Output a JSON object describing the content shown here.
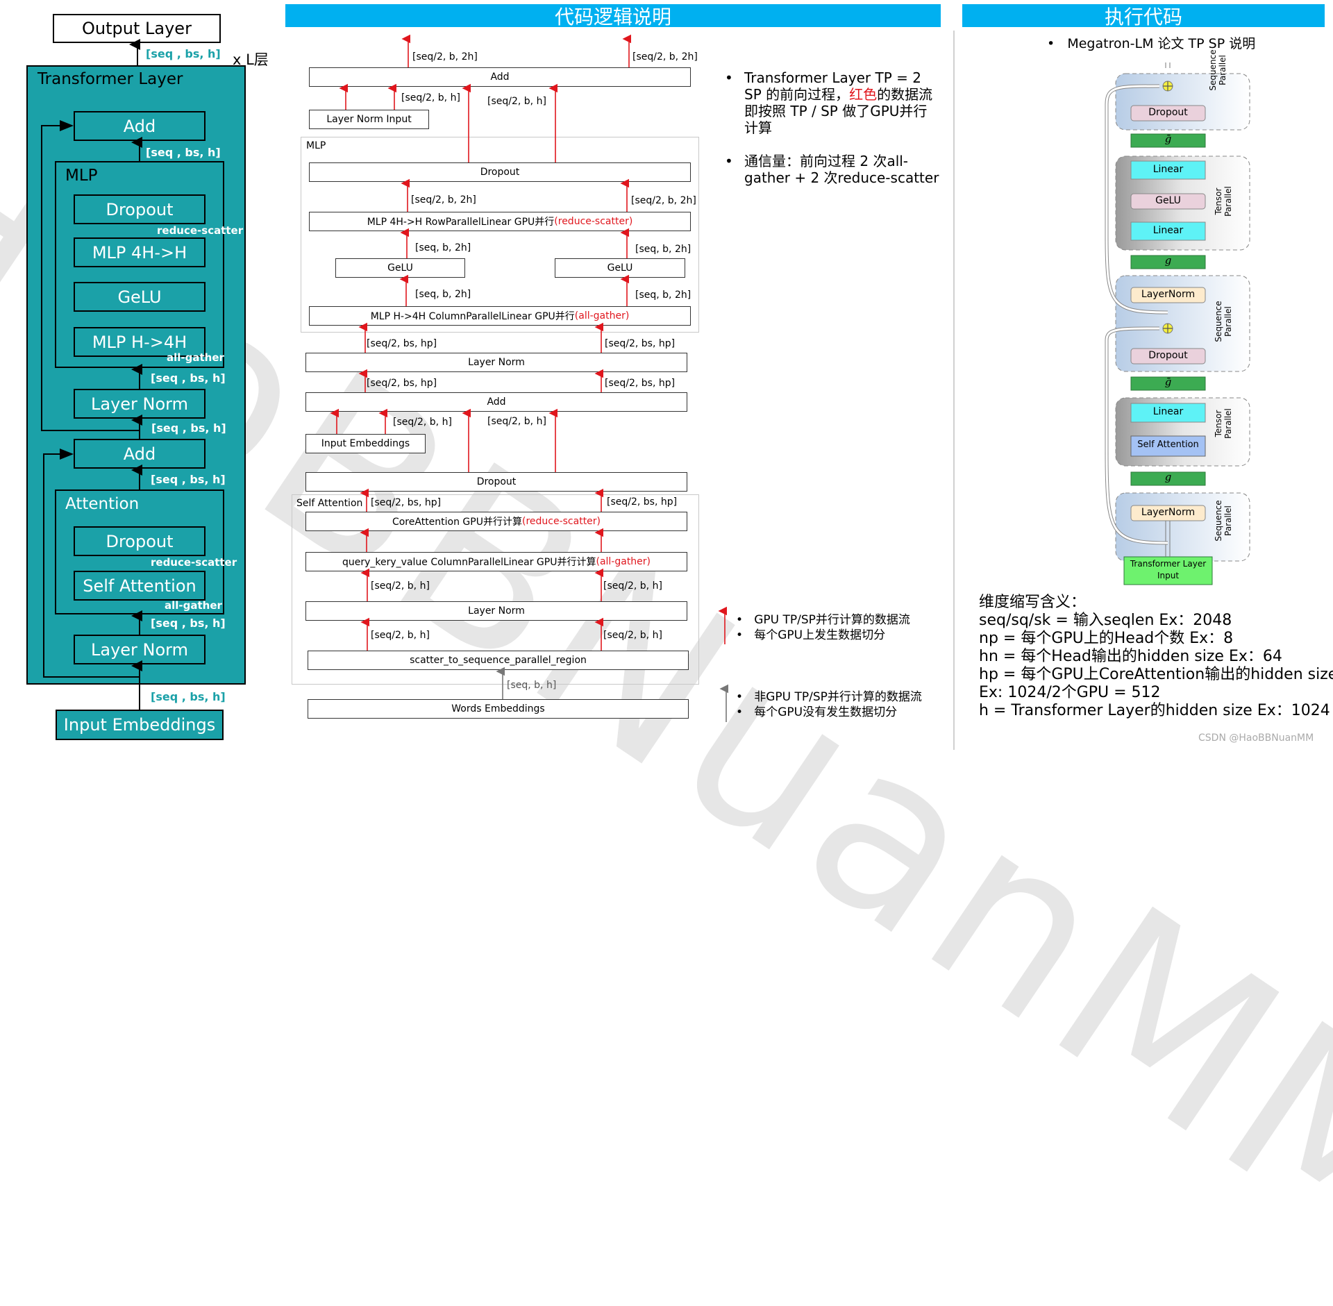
{
  "watermark": "HaoBBNuanMM",
  "left_diagram": {
    "output_layer": "Output Layer",
    "repeat_label": "x L层",
    "transformer_layer": "Transformer Layer",
    "input_embeddings": "Input Embeddings",
    "dim": "[seq , bs, h]",
    "add": "Add",
    "mlp_title": "MLP",
    "mlp_dropout": "Dropout",
    "mlp_4h_h": "MLP 4H->H",
    "gelu": "GeLU",
    "mlp_h_4h": "MLP H->4H",
    "layer_norm": "Layer Norm",
    "attention_title": "Attention",
    "attn_dropout": "Dropout",
    "self_attention": "Self Attention",
    "reduce_scatter": "reduce-scatter",
    "all_gather": "all-gather"
  },
  "middle": {
    "header": "代码逻辑说明",
    "boxes": {
      "add_top": "Add",
      "layer_norm_input": "Layer Norm Input",
      "mlp_group": "MLP",
      "mlp_dropout": "Dropout",
      "row_parallel": "MLP 4H->H RowParallelLinear GPU并行 ",
      "row_parallel_op": "(reduce-scatter)",
      "gelu_1": "GeLU",
      "gelu_2": "GeLU",
      "col_parallel": "MLP H->4H ColumnParallelLinear GPU并行 ",
      "col_parallel_op": "(all-gather)",
      "layer_norm": "Layer Norm",
      "add_mid": "Add",
      "input_embeddings": "Input Embeddings",
      "attn_dropout": "Dropout",
      "self_attention_group": "Self Attention",
      "core_attention": "CoreAttention GPU并行计算 ",
      "core_attention_op": "(reduce-scatter)",
      "qkv": "query_kery_value ColumnParallelLinear GPU并行计算 ",
      "qkv_op": "(all-gather)",
      "layer_norm_bottom": "Layer Norm",
      "scatter": "scatter_to_sequence_parallel_region",
      "words_embeddings": "Words Embeddings"
    },
    "dims": {
      "top_left": "[seq/2, b, 2h]",
      "top_right": "[seq/2, b, 2h]",
      "ln_in_right": "[seq/2, b, h]",
      "add_top_mid": "[seq/2, b, h]",
      "dropout_out_left": "[seq/2, b, 2h]",
      "dropout_out_right": "[seq/2, b, 2h]",
      "gelu_out_left": "[seq, b, 2h]",
      "gelu_out_right": "[seq, b, 2h]",
      "gelu_in_left": "[seq, b, 2h]",
      "gelu_in_right": "[seq, b, 2h]",
      "ln_out_left": "[seq/2, bs, hp]",
      "ln_out_right": "[seq/2, bs, hp]",
      "add_out_left": "[seq/2, bs, hp]",
      "add_out_right": "[seq/2, bs, hp]",
      "emb_out": "[seq/2, b, h]",
      "add_mid_in": "[seq/2, b, h]",
      "core_out_left": "[seq/2, bs, hp]",
      "core_out_right": "[seq/2, bs, hp]",
      "qkv_in_left": "[seq/2, b, h]",
      "qkv_in_right": "[seq/2, b, h]",
      "ln_b_in_left": "[seq/2, b, h]",
      "ln_b_in_right": "[seq/2, b, h]",
      "words_out": "[seq, b, h]"
    },
    "notes": {
      "bullet1_a": "Transformer Layer TP = 2  SP 的前向过程，",
      "bullet1_red": "红色",
      "bullet1_b": "的数据流即按照 TP / SP 做了GPU并行计算",
      "bullet2": "通信量：前向过程 2 次all-gather + 2 次reduce-scatter",
      "legend_red_1": "GPU TP/SP并行计算的数据流",
      "legend_red_2": "每个GPU上发生数据切分",
      "legend_gray_1": "非GPU TP/SP并行计算的数据流",
      "legend_gray_2": "每个GPU没有发生数据切分"
    }
  },
  "right": {
    "header": "执行代码",
    "subtitle": "Megatron-LM 论文 TP SP 说明",
    "figure": {
      "sequence_parallel": "Sequence Parallel",
      "tensor_parallel": "Tensor Parallel",
      "dropout": "Dropout",
      "linear": "Linear",
      "gelu": "GeLU",
      "layernorm": "LayerNorm",
      "self_attention": "Self Attention",
      "g": "g",
      "g_bar": "ḡ",
      "input_line1": "Transformer Layer",
      "input_line2": "Input"
    },
    "abbrev": {
      "title": "维度缩写含义：",
      "lines": [
        "seq/sq/sk = 输入seqlen Ex：2048",
        "np = 每个GPU上的Head个数 Ex：8",
        "hn = 每个Head输出的hidden size Ex：64",
        "hp  = 每个GPU上CoreAttention输出的hidden size",
        "Ex: 1024/2个GPU = 512",
        "h = Transformer Layer的hidden size Ex：1024"
      ]
    },
    "credit": "CSDN @HaoBBNuanMM"
  },
  "colors": {
    "teal": "#1ba1a8",
    "header_blue": "#00b0f0",
    "red": "#e0161d"
  }
}
